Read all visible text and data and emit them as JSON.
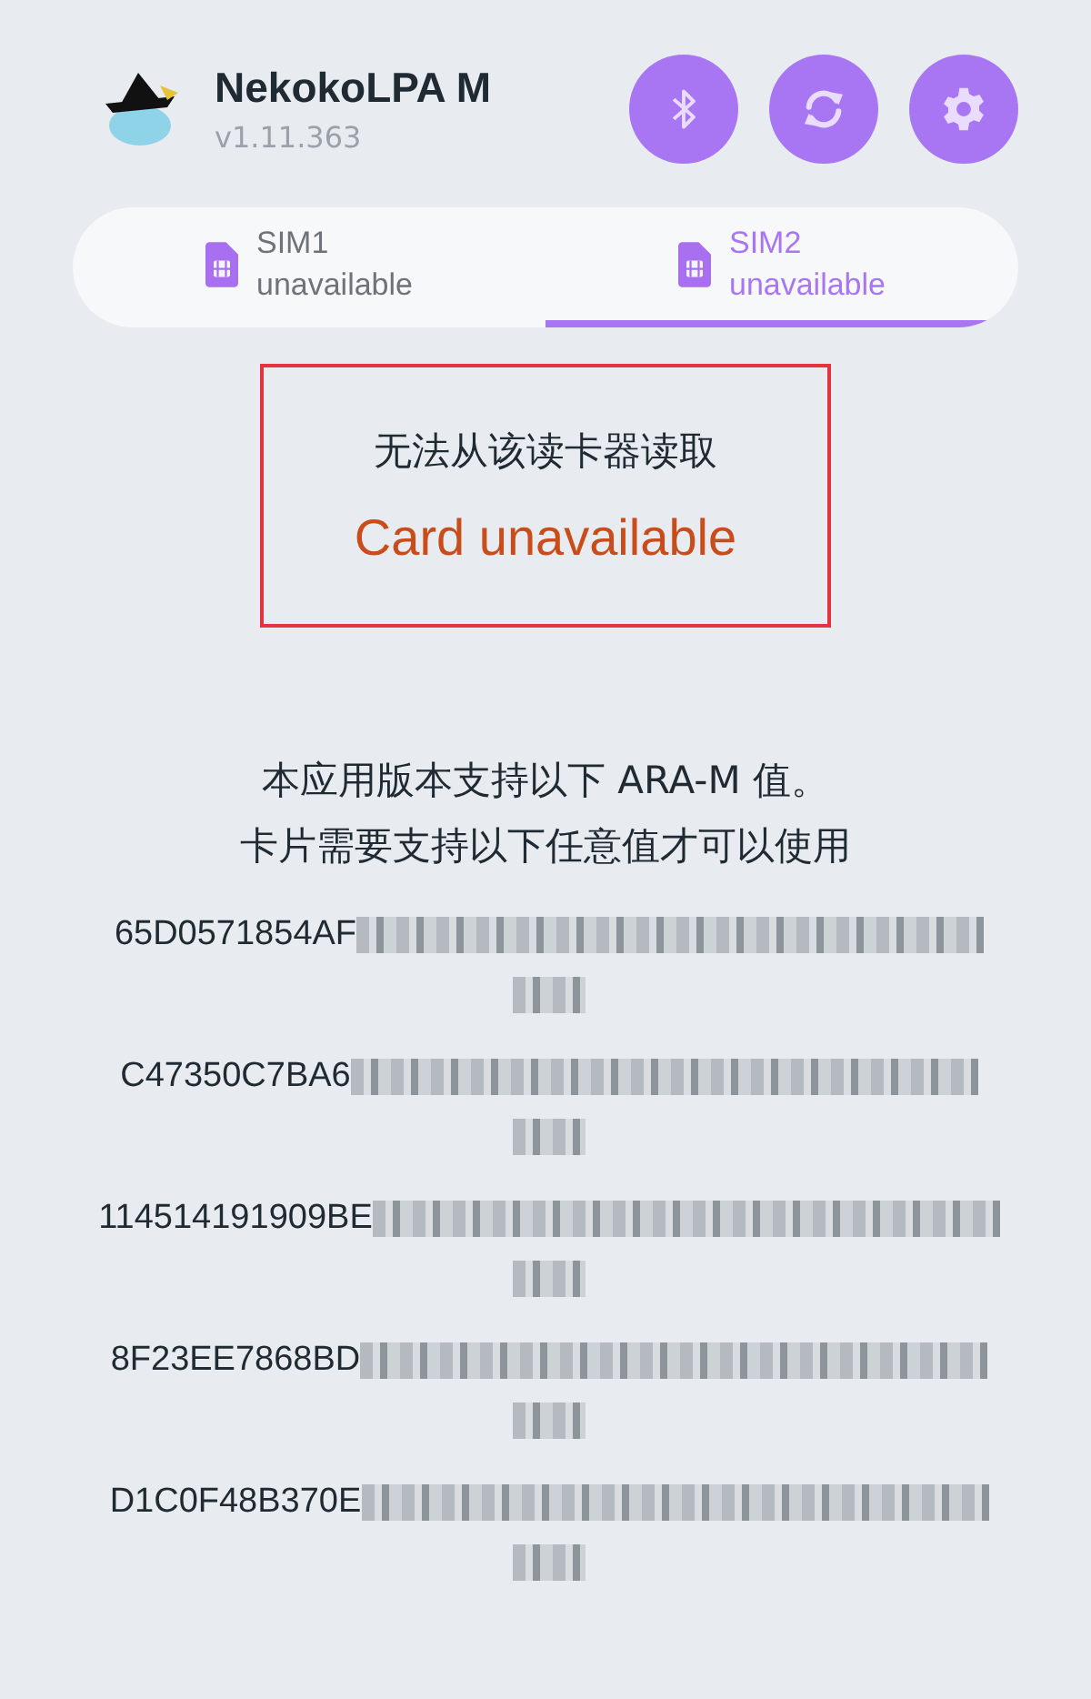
{
  "app": {
    "title": "NekokoLPA M",
    "version": "v1.11.363"
  },
  "tabs": [
    {
      "name": "SIM1",
      "status": "unavailable",
      "selected": false
    },
    {
      "name": "SIM2",
      "status": "unavailable",
      "selected": true
    }
  ],
  "error": {
    "message": "无法从该读卡器读取",
    "title": "Card unavailable"
  },
  "info": [
    "本应用版本支持以下 ARA-M 值。",
    "卡片需要支持以下任意值才可以使用"
  ],
  "ara_m_values": [
    {
      "prefix": "65D0571854AF"
    },
    {
      "prefix": "C47350C7BA6"
    },
    {
      "prefix": "114514191909BE"
    },
    {
      "prefix": "8F23EE7868BD"
    },
    {
      "prefix": "D1C0F48B370E"
    }
  ]
}
